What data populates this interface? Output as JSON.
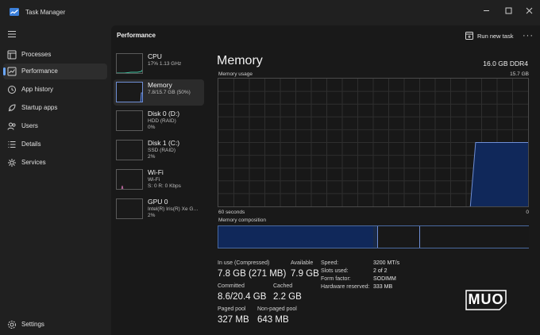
{
  "window": {
    "title": "Task Manager"
  },
  "sidebar": {
    "items": [
      {
        "label": "Processes",
        "icon": "processes-icon"
      },
      {
        "label": "Performance",
        "icon": "performance-icon",
        "active": true
      },
      {
        "label": "App history",
        "icon": "app-history-icon"
      },
      {
        "label": "Startup apps",
        "icon": "startup-apps-icon"
      },
      {
        "label": "Users",
        "icon": "users-icon"
      },
      {
        "label": "Details",
        "icon": "details-icon"
      },
      {
        "label": "Services",
        "icon": "services-icon"
      }
    ],
    "settings_label": "Settings"
  },
  "header": {
    "title": "Performance",
    "run_task_label": "Run new task",
    "more_label": "···"
  },
  "devices": [
    {
      "name": "CPU",
      "line1": "17%  1.13 GHz",
      "line2": ""
    },
    {
      "name": "Memory",
      "line1": "7.8/15.7 GB (50%)",
      "line2": "",
      "active": true
    },
    {
      "name": "Disk 0 (D:)",
      "line1": "HDD (RAID)",
      "line2": "0%"
    },
    {
      "name": "Disk 1 (C:)",
      "line1": "SSD (RAID)",
      "line2": "2%"
    },
    {
      "name": "Wi-Fi",
      "line1": "Wi-Fi",
      "line2": "S: 0  R: 0 Kbps"
    },
    {
      "name": "GPU 0",
      "line1": "Intel(R) Iris(R) Xe G…",
      "line2": "2%"
    }
  ],
  "memory": {
    "title": "Memory",
    "total": "16.0 GB DDR4",
    "usage_label": "Memory usage",
    "usage_max": "15.7 GB",
    "time_left": "60 seconds",
    "time_right": "0",
    "composition_label": "Memory composition",
    "usage_history_fraction": [
      0,
      0,
      0,
      0,
      0,
      0,
      0,
      0,
      0,
      0,
      0,
      0,
      0,
      0,
      0,
      0,
      0,
      0,
      0,
      0,
      0,
      0,
      0,
      0,
      0,
      0,
      0,
      0,
      0,
      0,
      0,
      0,
      0,
      0,
      0,
      0,
      0,
      0,
      0,
      0,
      0,
      0,
      0,
      0,
      0,
      0,
      0,
      0,
      0,
      0.5,
      0.5,
      0.5,
      0.5,
      0.5,
      0.5,
      0.5,
      0.5,
      0.5,
      0.5,
      0.5
    ],
    "composition_fractions": {
      "in_use": 0.5,
      "modified": 0.015,
      "standby": 0.135,
      "free": 0.35
    },
    "colors": {
      "accent": "#6f8fd6",
      "fill": "#10285a",
      "grid": "#2e2e2e"
    },
    "stats": {
      "in_use_label": "In use (Compressed)",
      "in_use": "7.8 GB (271 MB)",
      "available_label": "Available",
      "available": "7.9 GB",
      "committed_label": "Committed",
      "committed": "8.6/20.4 GB",
      "cached_label": "Cached",
      "cached": "2.2 GB",
      "paged_label": "Paged pool",
      "paged": "327 MB",
      "nonpaged_label": "Non-paged pool",
      "nonpaged": "643 MB"
    },
    "details": [
      {
        "label": "Speed:",
        "value": "3200 MT/s"
      },
      {
        "label": "Slots used:",
        "value": "2 of 2"
      },
      {
        "label": "Form factor:",
        "value": "SODIMM"
      },
      {
        "label": "Hardware reserved:",
        "value": "333 MB"
      }
    ]
  },
  "watermark": {
    "text": "MUO"
  }
}
